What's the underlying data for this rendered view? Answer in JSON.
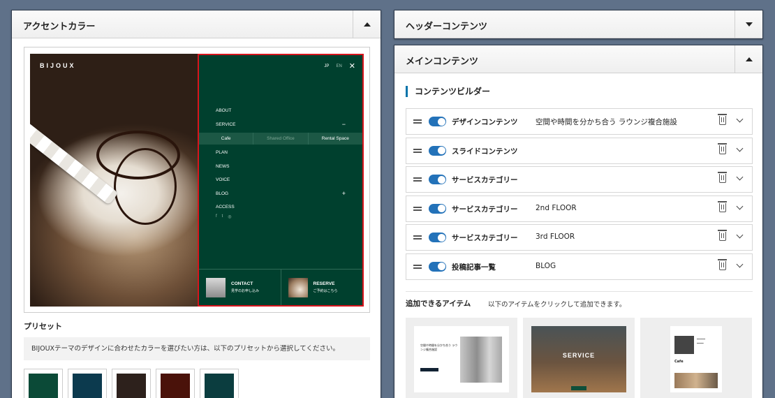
{
  "left_panel": {
    "title": "アクセントカラー",
    "preset_label": "プリセット",
    "preset_note": "BIJOUXテーマのデザインに合わせたカラーを選びたい方は、以下のプリセットから選択してください。",
    "swatches": [
      "#0b4a37",
      "#0c3a4e",
      "#2d211c",
      "#4a120a",
      "#0b3d3f"
    ]
  },
  "preview": {
    "brand": "BIJOUX",
    "lang_jp": "JP",
    "lang_en": "EN",
    "close": "✕",
    "menu": [
      "ABOUT",
      "SERVICE",
      "PLAN",
      "NEWS",
      "VOICE",
      "BLOG",
      "ACCESS"
    ],
    "service_toggle": "−",
    "blog_toggle": "+",
    "submenu": [
      "Cafe",
      "Shared Office",
      "Rental Space"
    ],
    "social": [
      "f",
      "t",
      "◎"
    ],
    "contact": {
      "title": "CONTACT",
      "sub": "見学のお申し込み"
    },
    "reserve": {
      "title": "RESERVE",
      "sub": "ご予約はこちら"
    },
    "menu_color": "#00402e",
    "highlight_color": "#d8141c"
  },
  "header_panel": {
    "title": "ヘッダーコンテンツ"
  },
  "main_panel": {
    "title": "メインコンテンツ",
    "section_title": "コンテンツビルダー",
    "rows": [
      {
        "name": "デザインコンテンツ",
        "sub": "空間や時間を分かち合う ラウンジ複合施設"
      },
      {
        "name": "スライドコンテンツ",
        "sub": ""
      },
      {
        "name": "サービスカテゴリー",
        "sub": ""
      },
      {
        "name": "サービスカテゴリー",
        "sub": "2nd FLOOR"
      },
      {
        "name": "サービスカテゴリー",
        "sub": "3rd FLOOR"
      },
      {
        "name": "投稿記事一覧",
        "sub": "BLOG"
      }
    ],
    "add_title": "追加できるアイテム",
    "add_note": "以下のアイテムをクリックして追加できます。",
    "card_texts": {
      "card1": "空間や時間を分かち合う ラウンジ複合施設",
      "card2": "SERVICE",
      "card3_cafe": "Cafe"
    },
    "toggle_color": "#2372b9"
  }
}
